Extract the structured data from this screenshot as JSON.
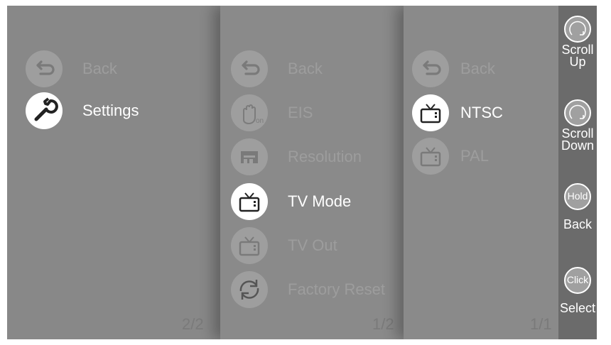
{
  "panel1": {
    "items": [
      {
        "label": "Back",
        "icon": "back-arrow-icon"
      },
      {
        "label": "Settings",
        "icon": "wrench-icon"
      }
    ],
    "page": "2/2"
  },
  "panel2": {
    "items": [
      {
        "label": "Back",
        "icon": "back-arrow-icon"
      },
      {
        "label": "EIS",
        "icon": "eis-hand-icon"
      },
      {
        "label": "Resolution",
        "icon": "resolution-icon"
      },
      {
        "label": "TV Mode",
        "icon": "tv-icon"
      },
      {
        "label": "TV Out",
        "icon": "tv-icon"
      },
      {
        "label": "Factory Reset",
        "icon": "reset-arrows-icon"
      }
    ],
    "page": "1/2"
  },
  "panel3": {
    "items": [
      {
        "label": "Back",
        "icon": "back-arrow-icon"
      },
      {
        "label": "NTSC",
        "icon": "tv-icon"
      },
      {
        "label": "PAL",
        "icon": "tv-icon"
      }
    ],
    "page": "1/1"
  },
  "sidebar": {
    "scroll_up": "Scroll Up",
    "scroll_down": "Scroll Down",
    "hold_circle": "Hold",
    "hold_label": "Back",
    "click_circle": "Click",
    "click_label": "Select"
  },
  "colors": {
    "panel_bg": "#888888",
    "sidebar_bg": "#6b6b6b",
    "active_text": "#ffffff",
    "inactive_text": "#9d9d9d"
  }
}
